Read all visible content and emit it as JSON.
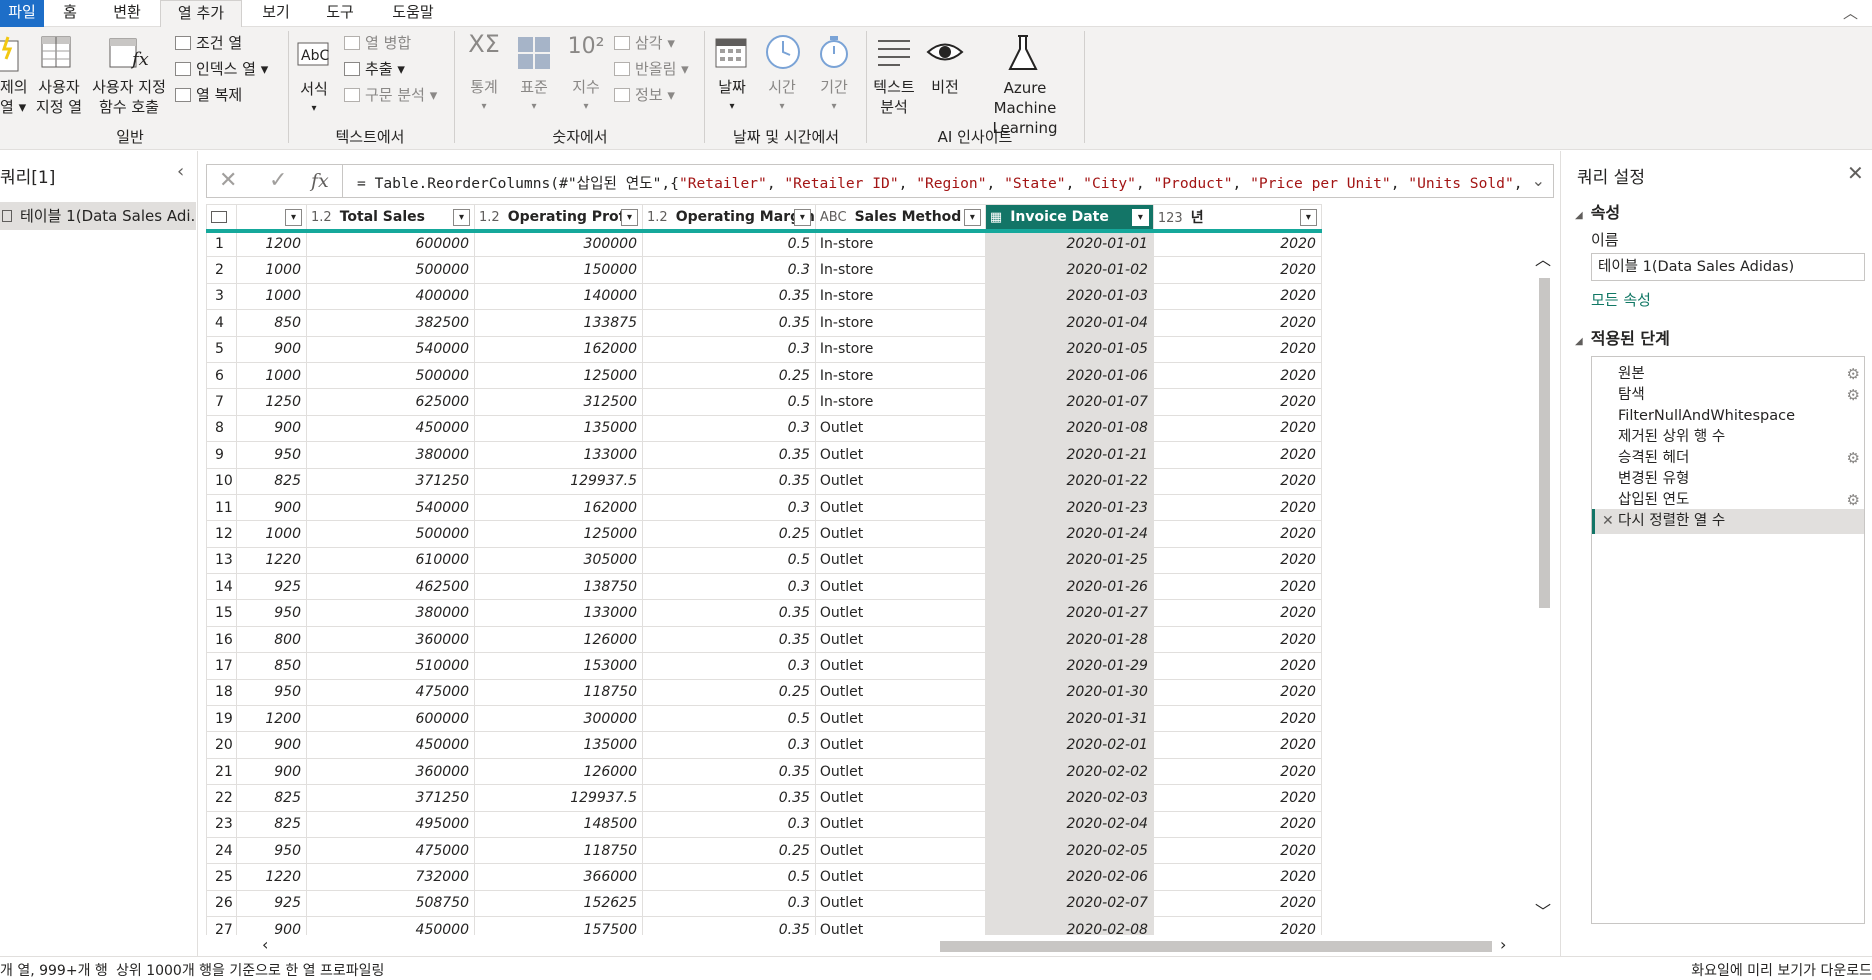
{
  "menu": {
    "tabs": [
      {
        "label": "파일"
      },
      {
        "label": "홈"
      },
      {
        "label": "변환"
      },
      {
        "label": "열 추가"
      },
      {
        "label": "보기"
      },
      {
        "label": "도구"
      },
      {
        "label": "도움말"
      }
    ],
    "collapse_glyph": "︿"
  },
  "ribbon": {
    "general": {
      "label": "일반",
      "example_col_1": "제의",
      "example_col_2": "열 ▾",
      "custom_col_1": "사용자",
      "custom_col_2": "지정 열",
      "invoke_fn_1": "사용자 지정",
      "invoke_fn_2": "함수 호출",
      "conditional_col": "조건 열",
      "index_col": "인덱스 열 ▾",
      "duplicate_col": "열 복제"
    },
    "from_text": {
      "label": "텍스트에서",
      "format": "서식",
      "format_arrow": "▾",
      "merge_cols": "열 병합",
      "extract": "추출 ▾",
      "parse": "구문 분석 ▾"
    },
    "from_number": {
      "label": "숫자에서",
      "statistics": "통계",
      "standard": "표준",
      "scientific": "지수",
      "trig": "삼각 ▾",
      "rounding": "반올림 ▾",
      "info": "정보 ▾",
      "arrow": "▾"
    },
    "from_datetime": {
      "label": "날짜 및 시간에서",
      "date": "날짜",
      "time": "시간",
      "duration": "기간",
      "arrow": "▾"
    },
    "ai": {
      "label": "AI 인사이트",
      "text_analytics_1": "텍스트",
      "text_analytics_2": "분석",
      "vision": "비전",
      "azure_ml_1": "Azure Machine",
      "azure_ml_2": "Learning"
    }
  },
  "queries_pane": {
    "title": "쿼리[1]",
    "collapse_glyph": "‹",
    "item": "테이블 1(Data Sales Adi..."
  },
  "formula_bar": {
    "cancel_glyph": "✕",
    "commit_glyph": "✓",
    "fx": "fx",
    "prefix": "= Table.ReorderColumns(#\"삽입된 연도\",{",
    "strings": [
      "\"Retailer\"",
      "\"Retailer ID\"",
      "\"Region\"",
      "\"State\"",
      "\"City\"",
      "\"Product\"",
      "\"Price per Unit\"",
      "\"Units Sold\""
    ],
    "separator": ", ",
    "suffix": ",",
    "expand_glyph": "⌄"
  },
  "grid": {
    "columns": [
      {
        "type": "",
        "name": ""
      },
      {
        "type": "1.2",
        "name": "Total Sales"
      },
      {
        "type": "1.2",
        "name": "Operating Profit"
      },
      {
        "type": "1.2",
        "name": "Operating Margin"
      },
      {
        "type": "ABC",
        "name": "Sales Method"
      },
      {
        "type": "▦",
        "name": "Invoice Date",
        "selected": true
      },
      {
        "type": "123",
        "name": "년"
      }
    ],
    "rows": [
      [
        "1200",
        "600000",
        "300000",
        "0.5",
        "In-store",
        "2020-01-01",
        "2020"
      ],
      [
        "1000",
        "500000",
        "150000",
        "0.3",
        "In-store",
        "2020-01-02",
        "2020"
      ],
      [
        "1000",
        "400000",
        "140000",
        "0.35",
        "In-store",
        "2020-01-03",
        "2020"
      ],
      [
        "850",
        "382500",
        "133875",
        "0.35",
        "In-store",
        "2020-01-04",
        "2020"
      ],
      [
        "900",
        "540000",
        "162000",
        "0.3",
        "In-store",
        "2020-01-05",
        "2020"
      ],
      [
        "1000",
        "500000",
        "125000",
        "0.25",
        "In-store",
        "2020-01-06",
        "2020"
      ],
      [
        "1250",
        "625000",
        "312500",
        "0.5",
        "In-store",
        "2020-01-07",
        "2020"
      ],
      [
        "900",
        "450000",
        "135000",
        "0.3",
        "Outlet",
        "2020-01-08",
        "2020"
      ],
      [
        "950",
        "380000",
        "133000",
        "0.35",
        "Outlet",
        "2020-01-21",
        "2020"
      ],
      [
        "825",
        "371250",
        "129937.5",
        "0.35",
        "Outlet",
        "2020-01-22",
        "2020"
      ],
      [
        "900",
        "540000",
        "162000",
        "0.3",
        "Outlet",
        "2020-01-23",
        "2020"
      ],
      [
        "1000",
        "500000",
        "125000",
        "0.25",
        "Outlet",
        "2020-01-24",
        "2020"
      ],
      [
        "1220",
        "610000",
        "305000",
        "0.5",
        "Outlet",
        "2020-01-25",
        "2020"
      ],
      [
        "925",
        "462500",
        "138750",
        "0.3",
        "Outlet",
        "2020-01-26",
        "2020"
      ],
      [
        "950",
        "380000",
        "133000",
        "0.35",
        "Outlet",
        "2020-01-27",
        "2020"
      ],
      [
        "800",
        "360000",
        "126000",
        "0.35",
        "Outlet",
        "2020-01-28",
        "2020"
      ],
      [
        "850",
        "510000",
        "153000",
        "0.3",
        "Outlet",
        "2020-01-29",
        "2020"
      ],
      [
        "950",
        "475000",
        "118750",
        "0.25",
        "Outlet",
        "2020-01-30",
        "2020"
      ],
      [
        "1200",
        "600000",
        "300000",
        "0.5",
        "Outlet",
        "2020-01-31",
        "2020"
      ],
      [
        "900",
        "450000",
        "135000",
        "0.3",
        "Outlet",
        "2020-02-01",
        "2020"
      ],
      [
        "900",
        "360000",
        "126000",
        "0.35",
        "Outlet",
        "2020-02-02",
        "2020"
      ],
      [
        "825",
        "371250",
        "129937.5",
        "0.35",
        "Outlet",
        "2020-02-03",
        "2020"
      ],
      [
        "825",
        "495000",
        "148500",
        "0.3",
        "Outlet",
        "2020-02-04",
        "2020"
      ],
      [
        "950",
        "475000",
        "118750",
        "0.25",
        "Outlet",
        "2020-02-05",
        "2020"
      ],
      [
        "1220",
        "732000",
        "366000",
        "0.5",
        "Outlet",
        "2020-02-06",
        "2020"
      ],
      [
        "925",
        "508750",
        "152625",
        "0.3",
        "Outlet",
        "2020-02-07",
        "2020"
      ],
      [
        "900",
        "450000",
        "157500",
        "0.35",
        "Outlet",
        "2020-02-08",
        "2020"
      ]
    ],
    "scroll": {
      "up": "︿",
      "down": "﹀",
      "left": "‹",
      "right": "›"
    }
  },
  "query_settings": {
    "title": "쿼리 설정",
    "close_glyph": "✕",
    "properties_title": "속성",
    "name_label": "이름",
    "name_value": "테이블 1(Data Sales Adidas)",
    "all_properties": "모든 속성",
    "applied_steps_title": "적용된 단계",
    "steps": [
      {
        "label": "원본",
        "gear": true
      },
      {
        "label": "탐색",
        "gear": true
      },
      {
        "label": "FilterNullAndWhitespace",
        "gear": false
      },
      {
        "label": "제거된 상위 행 수",
        "gear": false
      },
      {
        "label": "승격된 헤더",
        "gear": true
      },
      {
        "label": "변경된 유형",
        "gear": false
      },
      {
        "label": "삽입된 연도",
        "gear": true
      },
      {
        "label": "다시 정렬한 열 수",
        "gear": false,
        "active": true
      }
    ],
    "gear_glyph": "⚙",
    "delete_glyph": "✕",
    "triangle_glyph": "◢"
  },
  "status": {
    "left": "개 열, 999+개 행",
    "middle": "상위 1000개 행을 기준으로 한 열 프로파일링",
    "right": "화요일에 미리 보기가 다운로드"
  },
  "colors": {
    "accent": "#137567",
    "header_underline": "#15a89b",
    "file_tab": "#1d6ec8"
  }
}
